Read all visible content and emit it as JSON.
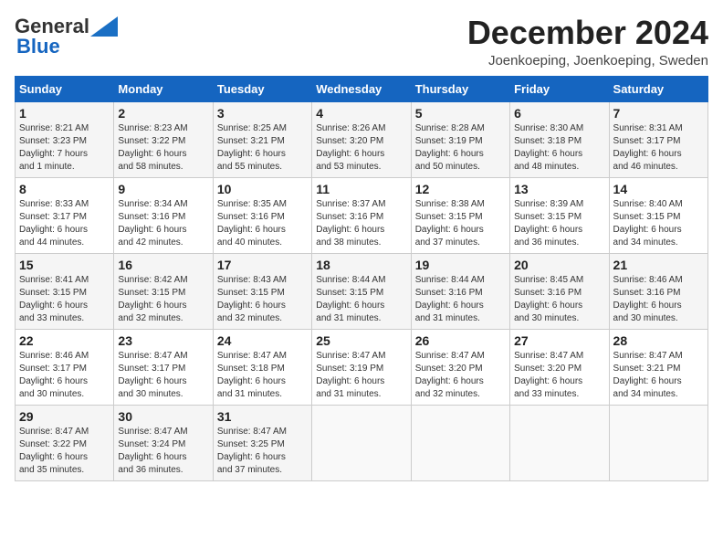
{
  "header": {
    "logo_general": "General",
    "logo_blue": "Blue",
    "month_title": "December 2024",
    "location": "Joenkoeping, Joenkoeping, Sweden"
  },
  "weekdays": [
    "Sunday",
    "Monday",
    "Tuesday",
    "Wednesday",
    "Thursday",
    "Friday",
    "Saturday"
  ],
  "weeks": [
    [
      {
        "day": "1",
        "sunrise": "8:21 AM",
        "sunset": "3:23 PM",
        "daylight": "7 hours and 1 minute."
      },
      {
        "day": "2",
        "sunrise": "8:23 AM",
        "sunset": "3:22 PM",
        "daylight": "6 hours and 58 minutes."
      },
      {
        "day": "3",
        "sunrise": "8:25 AM",
        "sunset": "3:21 PM",
        "daylight": "6 hours and 55 minutes."
      },
      {
        "day": "4",
        "sunrise": "8:26 AM",
        "sunset": "3:20 PM",
        "daylight": "6 hours and 53 minutes."
      },
      {
        "day": "5",
        "sunrise": "8:28 AM",
        "sunset": "3:19 PM",
        "daylight": "6 hours and 50 minutes."
      },
      {
        "day": "6",
        "sunrise": "8:30 AM",
        "sunset": "3:18 PM",
        "daylight": "6 hours and 48 minutes."
      },
      {
        "day": "7",
        "sunrise": "8:31 AM",
        "sunset": "3:17 PM",
        "daylight": "6 hours and 46 minutes."
      }
    ],
    [
      {
        "day": "8",
        "sunrise": "8:33 AM",
        "sunset": "3:17 PM",
        "daylight": "6 hours and 44 minutes."
      },
      {
        "day": "9",
        "sunrise": "8:34 AM",
        "sunset": "3:16 PM",
        "daylight": "6 hours and 42 minutes."
      },
      {
        "day": "10",
        "sunrise": "8:35 AM",
        "sunset": "3:16 PM",
        "daylight": "6 hours and 40 minutes."
      },
      {
        "day": "11",
        "sunrise": "8:37 AM",
        "sunset": "3:16 PM",
        "daylight": "6 hours and 38 minutes."
      },
      {
        "day": "12",
        "sunrise": "8:38 AM",
        "sunset": "3:15 PM",
        "daylight": "6 hours and 37 minutes."
      },
      {
        "day": "13",
        "sunrise": "8:39 AM",
        "sunset": "3:15 PM",
        "daylight": "6 hours and 36 minutes."
      },
      {
        "day": "14",
        "sunrise": "8:40 AM",
        "sunset": "3:15 PM",
        "daylight": "6 hours and 34 minutes."
      }
    ],
    [
      {
        "day": "15",
        "sunrise": "8:41 AM",
        "sunset": "3:15 PM",
        "daylight": "6 hours and 33 minutes."
      },
      {
        "day": "16",
        "sunrise": "8:42 AM",
        "sunset": "3:15 PM",
        "daylight": "6 hours and 32 minutes."
      },
      {
        "day": "17",
        "sunrise": "8:43 AM",
        "sunset": "3:15 PM",
        "daylight": "6 hours and 32 minutes."
      },
      {
        "day": "18",
        "sunrise": "8:44 AM",
        "sunset": "3:15 PM",
        "daylight": "6 hours and 31 minutes."
      },
      {
        "day": "19",
        "sunrise": "8:44 AM",
        "sunset": "3:16 PM",
        "daylight": "6 hours and 31 minutes."
      },
      {
        "day": "20",
        "sunrise": "8:45 AM",
        "sunset": "3:16 PM",
        "daylight": "6 hours and 30 minutes."
      },
      {
        "day": "21",
        "sunrise": "8:46 AM",
        "sunset": "3:16 PM",
        "daylight": "6 hours and 30 minutes."
      }
    ],
    [
      {
        "day": "22",
        "sunrise": "8:46 AM",
        "sunset": "3:17 PM",
        "daylight": "6 hours and 30 minutes."
      },
      {
        "day": "23",
        "sunrise": "8:47 AM",
        "sunset": "3:17 PM",
        "daylight": "6 hours and 30 minutes."
      },
      {
        "day": "24",
        "sunrise": "8:47 AM",
        "sunset": "3:18 PM",
        "daylight": "6 hours and 31 minutes."
      },
      {
        "day": "25",
        "sunrise": "8:47 AM",
        "sunset": "3:19 PM",
        "daylight": "6 hours and 31 minutes."
      },
      {
        "day": "26",
        "sunrise": "8:47 AM",
        "sunset": "3:20 PM",
        "daylight": "6 hours and 32 minutes."
      },
      {
        "day": "27",
        "sunrise": "8:47 AM",
        "sunset": "3:20 PM",
        "daylight": "6 hours and 33 minutes."
      },
      {
        "day": "28",
        "sunrise": "8:47 AM",
        "sunset": "3:21 PM",
        "daylight": "6 hours and 34 minutes."
      }
    ],
    [
      {
        "day": "29",
        "sunrise": "8:47 AM",
        "sunset": "3:22 PM",
        "daylight": "6 hours and 35 minutes."
      },
      {
        "day": "30",
        "sunrise": "8:47 AM",
        "sunset": "3:24 PM",
        "daylight": "6 hours and 36 minutes."
      },
      {
        "day": "31",
        "sunrise": "8:47 AM",
        "sunset": "3:25 PM",
        "daylight": "6 hours and 37 minutes."
      },
      null,
      null,
      null,
      null
    ]
  ]
}
